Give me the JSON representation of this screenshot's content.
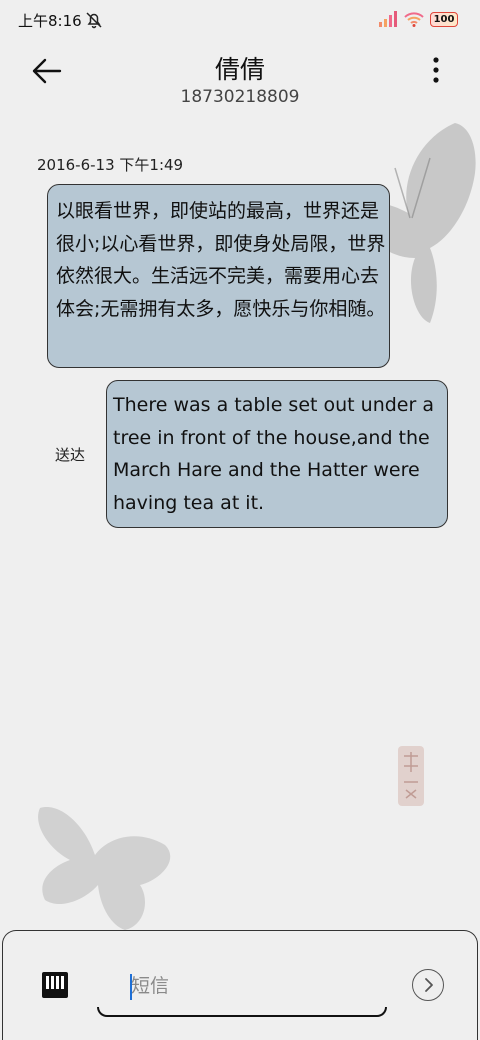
{
  "status_bar": {
    "time": "上午8:16",
    "battery": "100"
  },
  "header": {
    "contact_name": "倩倩",
    "contact_number": "18730218809"
  },
  "conversation": {
    "timestamp": "2016-6-13 下午1:49",
    "messages": [
      {
        "direction": "received",
        "text": "以眼看世界，即使站的最高，世界还是很小;以心看世界，即使身处局限，世界依然很大。生活远不完美，需要用心去体会;无需拥有太多，愿快乐与你相随。"
      },
      {
        "direction": "sent",
        "text": "There was a table set out under a tree in front of the house,and the March Hare and the Hatter were having tea at it.",
        "status": "送达"
      }
    ]
  },
  "composer": {
    "placeholder": "短信"
  },
  "icons": {
    "back": "arrow-left-icon",
    "more": "more-vertical-icon",
    "keyboard": "keyboard-icon",
    "send": "chevron-right-circle-icon",
    "mute": "bell-off-icon"
  },
  "colors": {
    "bubble": "#b6c7d3",
    "background": "#efefef",
    "caret": "#1e6fd6"
  }
}
